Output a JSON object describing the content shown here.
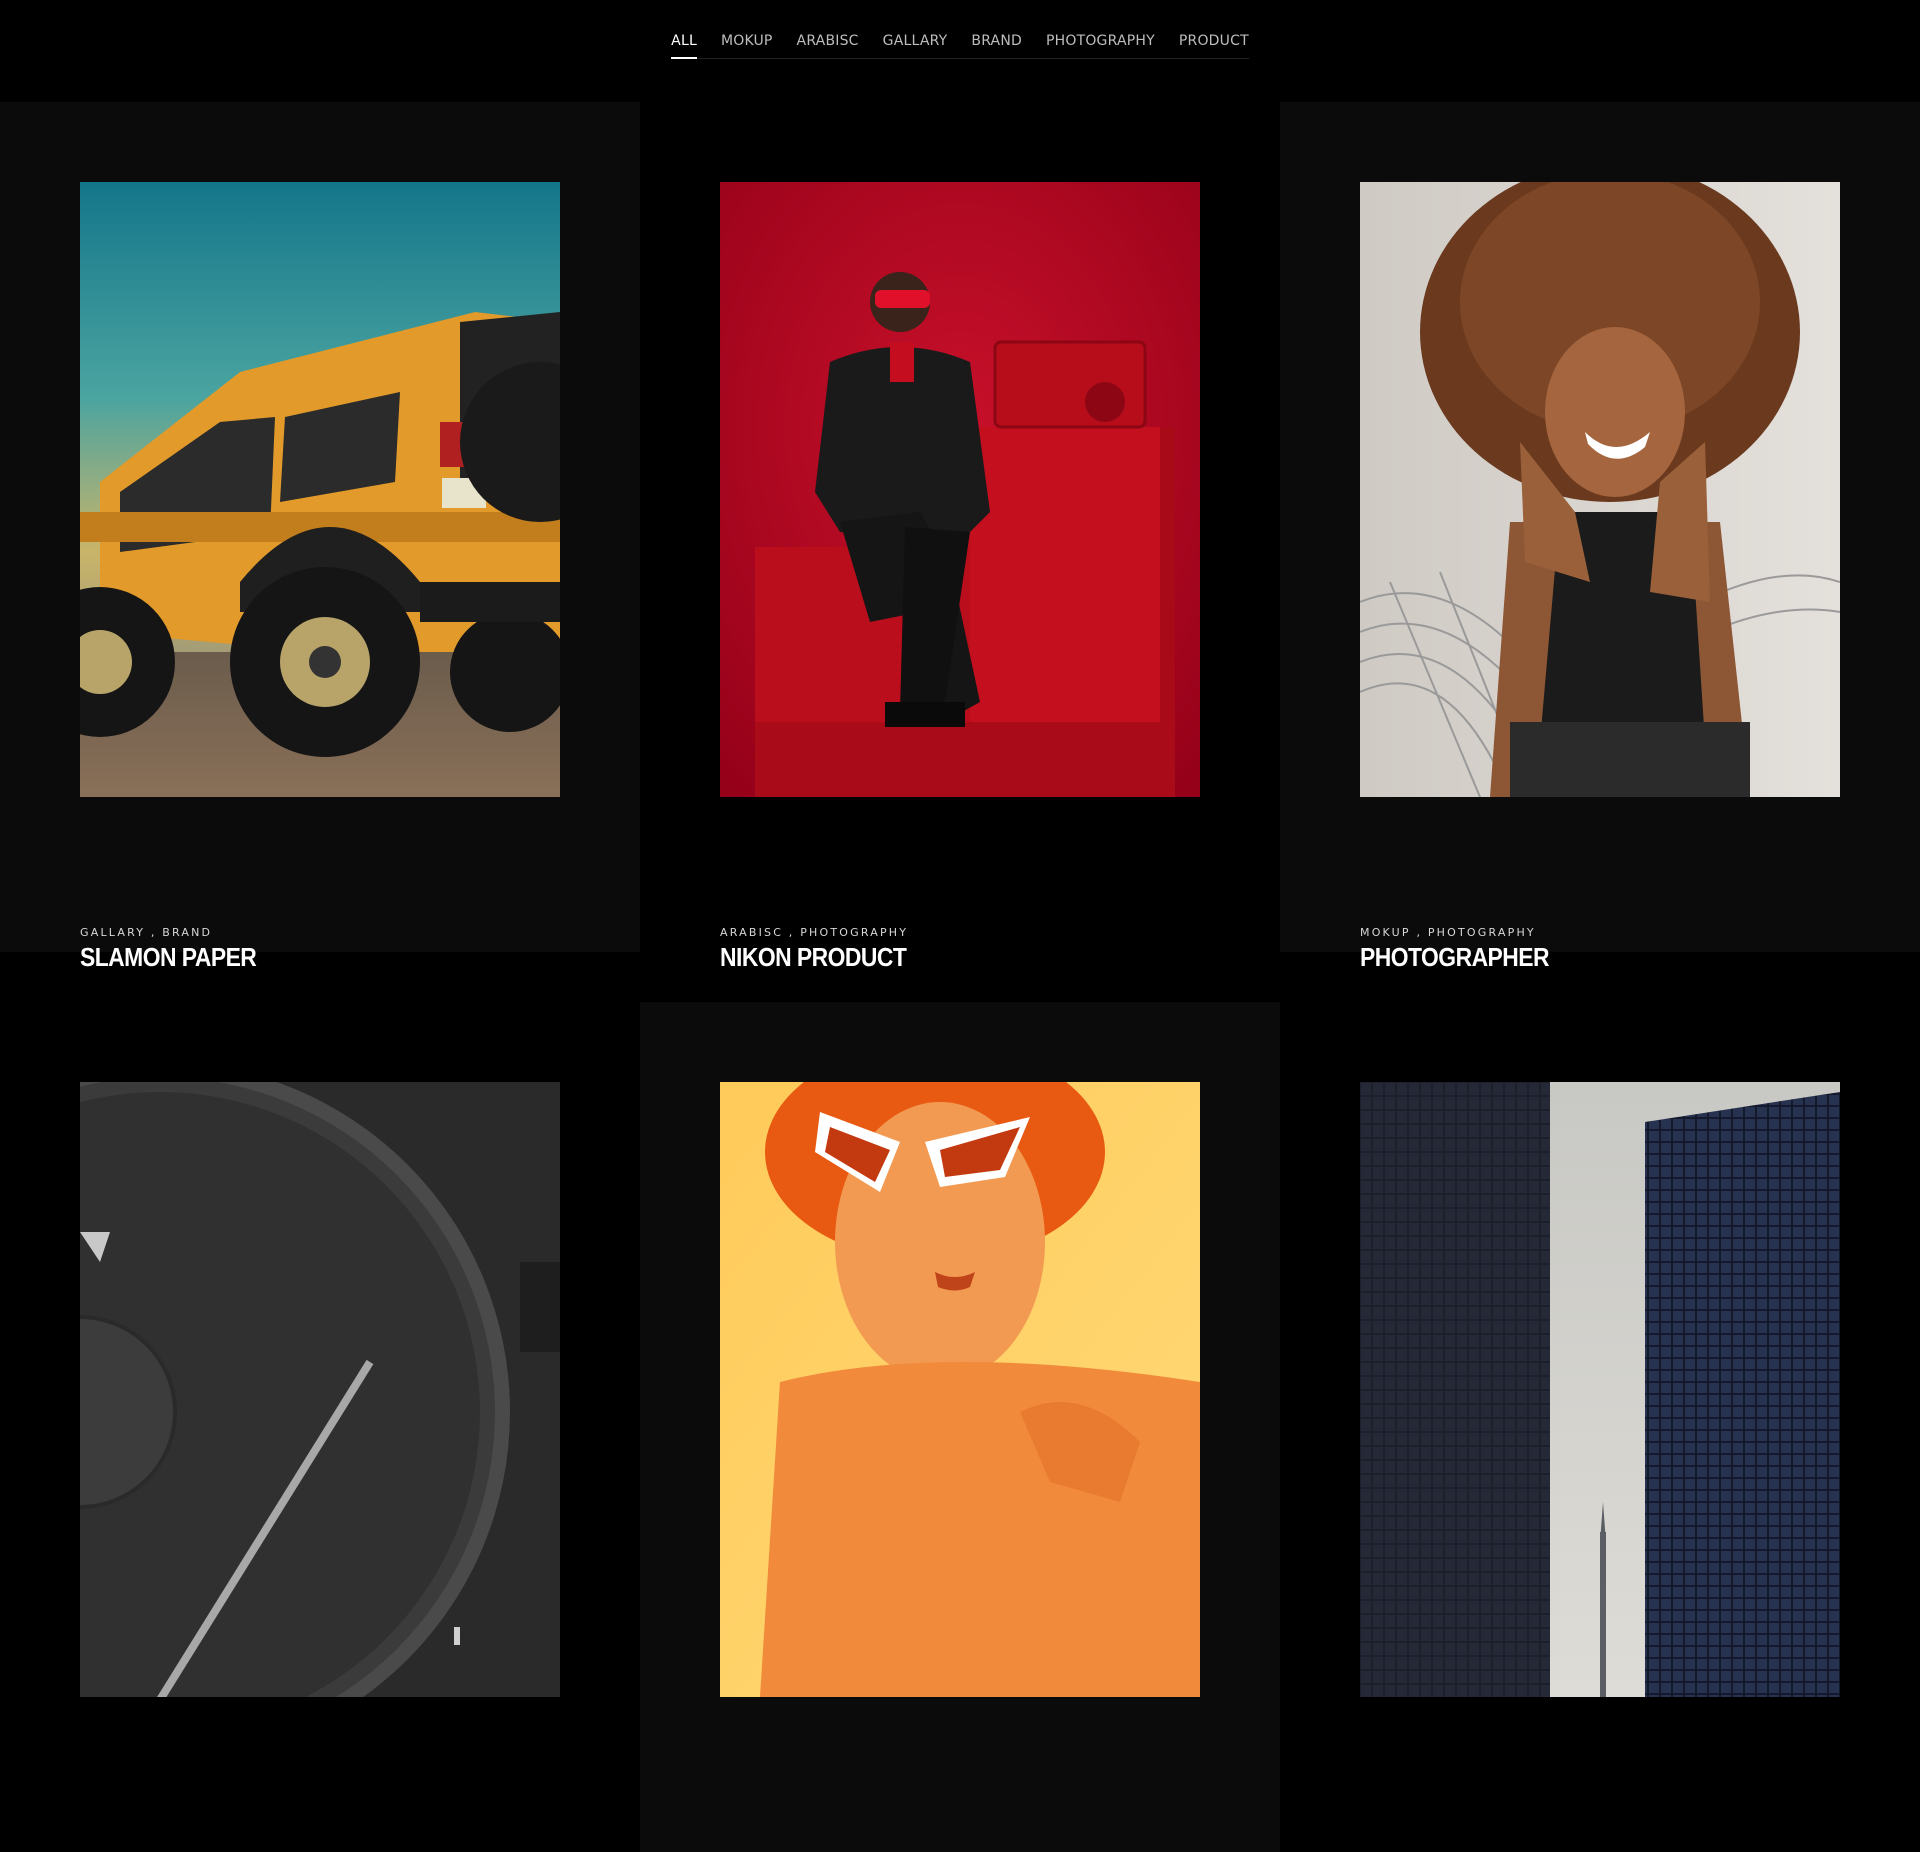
{
  "filters": {
    "items": [
      {
        "label": "ALL"
      },
      {
        "label": "MOKUP"
      },
      {
        "label": "ARABISC"
      },
      {
        "label": "GALLARY"
      },
      {
        "label": "BRAND"
      },
      {
        "label": "PHOTOGRAPHY"
      },
      {
        "label": "PRODUCT"
      }
    ],
    "active": "ALL"
  },
  "portfolio": {
    "items": [
      {
        "categories": "GALLARY , BRAND",
        "title": "SLAMON PAPER",
        "image": "yellow-jeep-photo"
      },
      {
        "categories": "ARABISC , PHOTOGRAPHY",
        "title": "NIKON PRODUCT",
        "image": "man-red-background-photo"
      },
      {
        "categories": "MOKUP , PHOTOGRAPHY",
        "title": "PHOTOGRAPHER",
        "image": "smiling-woman-photo"
      },
      {
        "image": "watch-closeup-photo"
      },
      {
        "image": "woman-sunglasses-orange-photo"
      },
      {
        "image": "skyscrapers-photo"
      }
    ]
  },
  "colors": {
    "background": "#000000",
    "card_shade": "#0b0b0b",
    "nav_text": "#bdbdbd",
    "nav_active": "#ffffff"
  }
}
